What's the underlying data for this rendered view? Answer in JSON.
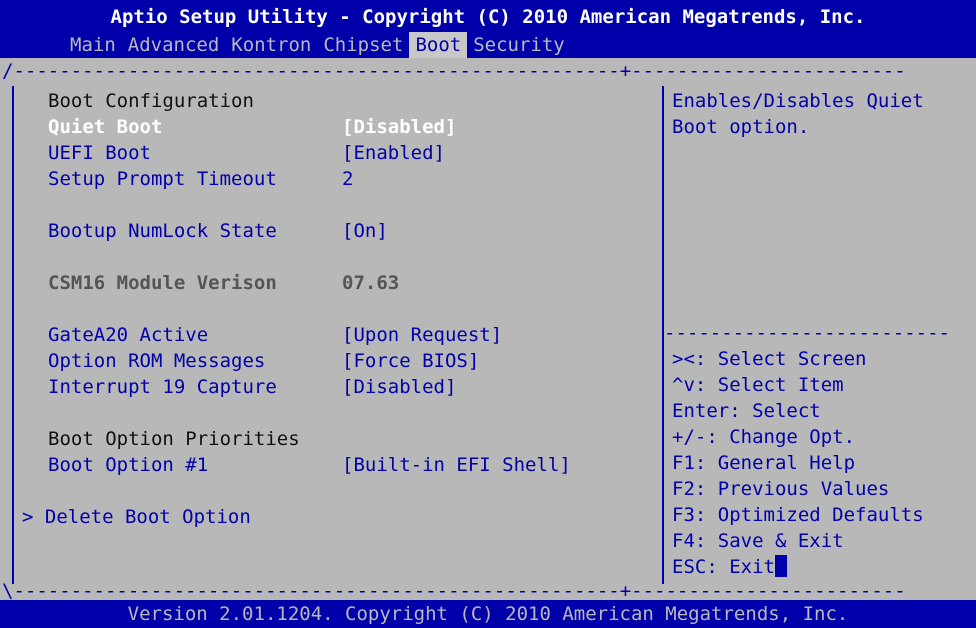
{
  "header": {
    "title": "Aptio Setup Utility - Copyright (C) 2010 American Megatrends, Inc.",
    "tabs": [
      "Main",
      "Advanced",
      "Kontron",
      "Chipset",
      "Boot",
      "Security"
    ],
    "active_tab": "Boot"
  },
  "settings": {
    "section_boot_config": "Boot Configuration",
    "quiet_boot": {
      "label": "Quiet Boot",
      "value": "[Disabled]"
    },
    "uefi_boot": {
      "label": "UEFI Boot",
      "value": "[Enabled]"
    },
    "setup_prompt_timeout": {
      "label": "Setup Prompt Timeout",
      "value": "2"
    },
    "bootup_numlock": {
      "label": "Bootup NumLock State",
      "value": "[On]"
    },
    "csm16_version": {
      "label": "CSM16 Module Verison",
      "value": "07.63"
    },
    "gatea20": {
      "label": "GateA20 Active",
      "value": "[Upon Request]"
    },
    "option_rom": {
      "label": "Option ROM Messages",
      "value": "[Force BIOS]"
    },
    "interrupt19": {
      "label": "Interrupt 19 Capture",
      "value": "[Disabled]"
    },
    "section_boot_priorities": "Boot Option Priorities",
    "boot_option_1": {
      "label": "Boot Option #1",
      "value": "[Built-in EFI Shell]"
    },
    "delete_boot_option": {
      "label": "> Delete Boot Option"
    }
  },
  "help": {
    "line1": "Enables/Disables Quiet",
    "line2": "Boot option."
  },
  "keys": {
    "select_screen": "><: Select Screen",
    "select_item": "^v: Select Item",
    "enter": "Enter: Select",
    "change_opt": "+/-: Change Opt.",
    "f1": "F1: General Help",
    "f2": "F2: Previous Values",
    "f3": "F3: Optimized Defaults",
    "f4": "F4: Save & Exit",
    "esc": "ESC: Exit"
  },
  "footer": {
    "text": "Version 2.01.1204. Copyright (C) 2010 American Megatrends, Inc."
  },
  "colors": {
    "background": "#b8b8b8",
    "accent_blue": "#0000aa",
    "highlight_white": "#ffffff"
  }
}
